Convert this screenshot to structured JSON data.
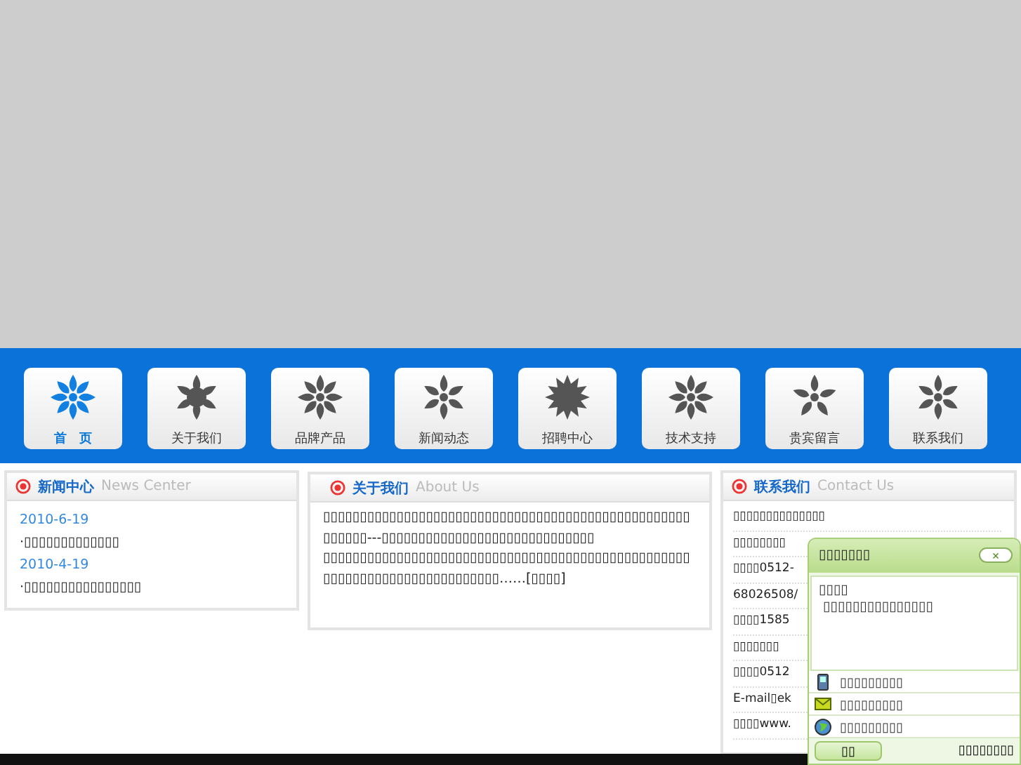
{
  "nav": [
    {
      "label": "首　页",
      "selected": true
    },
    {
      "label": "关于我们",
      "selected": false
    },
    {
      "label": "品牌产品",
      "selected": false
    },
    {
      "label": "新闻动态",
      "selected": false
    },
    {
      "label": "招聘中心",
      "selected": false
    },
    {
      "label": "技术支持",
      "selected": false
    },
    {
      "label": "贵宾留言",
      "selected": false
    },
    {
      "label": "联系我们",
      "selected": false
    }
  ],
  "news": {
    "title": "新闻中心",
    "subtitle": "News Center",
    "items": [
      {
        "date": "2010-6-19",
        "text": "·▯▯▯▯▯▯▯▯▯▯▯▯▯"
      },
      {
        "date": "2010-4-19",
        "text": "·▯▯▯▯▯▯▯▯▯▯▯▯▯▯▯▯"
      }
    ]
  },
  "about": {
    "title": "关于我们",
    "subtitle": "About Us",
    "paragraphs": [
      "▯▯▯▯▯▯▯▯▯▯▯▯▯▯▯▯▯▯▯▯▯▯▯▯▯▯▯▯▯▯▯▯▯▯▯▯▯▯▯▯▯▯▯▯▯▯▯▯▯▯▯▯▯▯▯▯---▯▯▯▯▯▯▯▯▯▯▯▯▯▯▯▯▯▯▯▯▯▯▯▯▯▯▯▯▯",
      "▯▯▯▯▯▯▯▯▯▯▯▯▯▯▯▯▯▯▯▯▯▯▯▯▯▯▯▯▯▯▯▯▯▯▯▯▯▯▯▯▯▯▯▯▯▯▯▯▯▯▯▯▯▯▯▯▯▯▯▯▯▯▯▯▯▯▯▯▯▯▯▯▯▯……[▯▯▯▯]"
    ]
  },
  "contact": {
    "title": "联系我们",
    "subtitle": "Contact Us",
    "lines": [
      "▯▯▯▯▯▯▯▯▯▯▯▯▯▯",
      "▯▯▯▯▯▯▯▯",
      "▯▯▯▯0512-",
      "68026508/",
      "▯▯▯▯1585",
      "▯▯▯▯▯▯▯",
      "▯▯▯▯0512",
      "E-mail▯ek",
      "▯▯▯▯www."
    ]
  },
  "chat": {
    "title": "▯▯▯▯▯▯▯",
    "close": "×",
    "greeting": "▯▯▯▯",
    "message": "▯▯▯▯▯▯▯▯▯▯▯▯▯▯▯",
    "fields": [
      {
        "kind": "phone",
        "placeholder": "▯▯▯▯▯▯▯▯▯"
      },
      {
        "kind": "mail",
        "placeholder": "▯▯▯▯▯▯▯▯▯"
      },
      {
        "kind": "web",
        "placeholder": "▯▯▯▯▯▯▯▯▯"
      }
    ],
    "send": "▯▯",
    "note": "▯▯▯▯▯▯▯▯"
  }
}
